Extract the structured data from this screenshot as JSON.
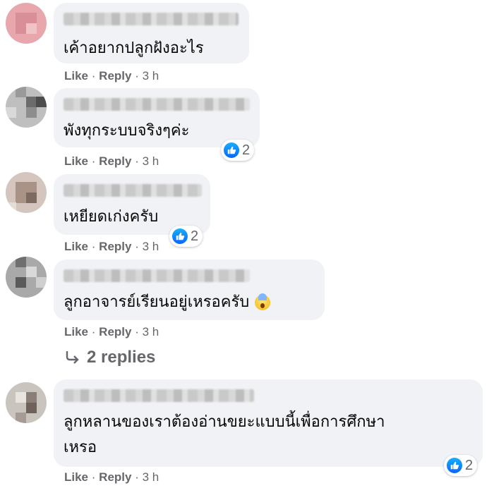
{
  "comments": [
    {
      "text_lines": [
        "เค้าอยากปลูกฝังอะไร"
      ],
      "reactions": null,
      "meta": {
        "like": "Like",
        "reply": "Reply",
        "time": "3 h"
      }
    },
    {
      "text_lines": [
        "พังทุกระบบจริงๆค่ะ"
      ],
      "reactions": "2",
      "meta": {
        "like": "Like",
        "reply": "Reply",
        "time": "3 h"
      }
    },
    {
      "text_lines": [
        "เหยียดเก่งครับ"
      ],
      "reactions": "2",
      "meta": {
        "like": "Like",
        "reply": "Reply",
        "time": "3 h"
      }
    },
    {
      "text_lines": [
        "ลูกอาจารย์เรียนอยู่เหรอครับ"
      ],
      "reactions": null,
      "emoji": "face-screaming-in-fear",
      "meta": {
        "like": "Like",
        "reply": "Reply",
        "time": "3 h"
      },
      "replies_label": "2 replies"
    },
    {
      "text_lines": [
        "ลูกหลานของเราต้องอ่านขยะแบบนี้เพื่อการศึกษา",
        "เหรอ"
      ],
      "reactions": "2",
      "meta": {
        "like": "Like",
        "reply": "Reply",
        "time": "3 h"
      }
    }
  ],
  "meta_separator": "·",
  "colors": {
    "bubble": "#f0f2f5",
    "meta_text": "#65676b",
    "like_blue": "#0866ff"
  }
}
